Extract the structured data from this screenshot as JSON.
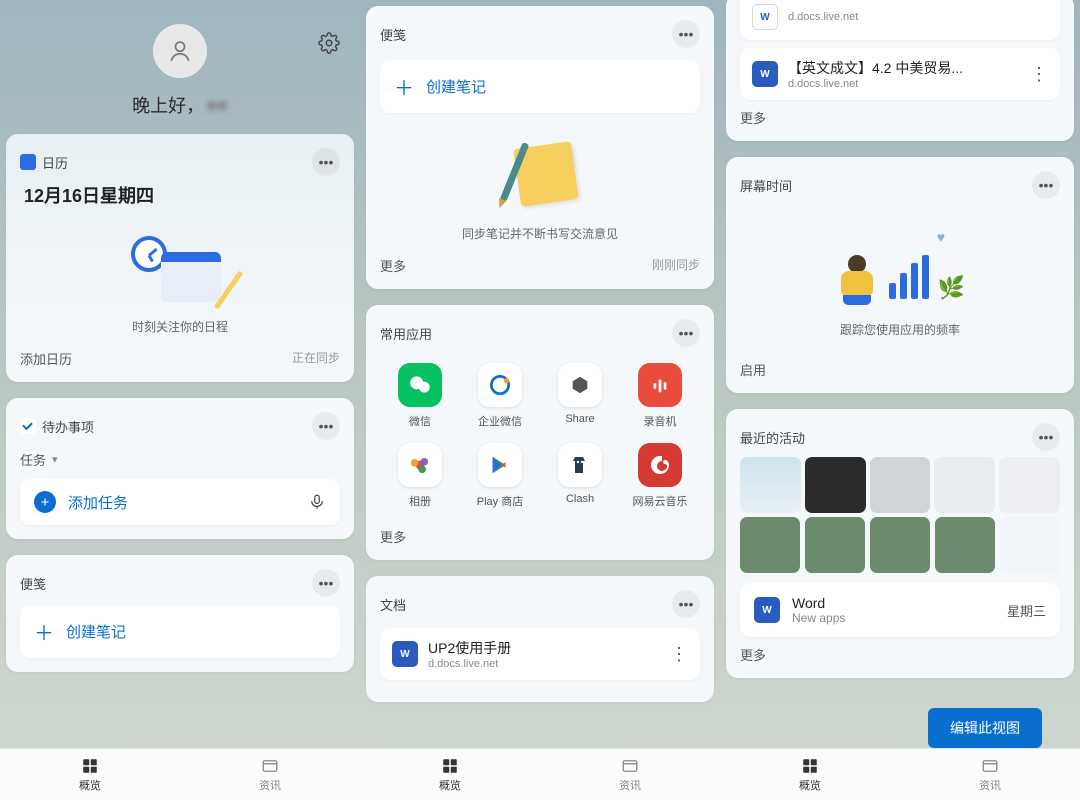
{
  "profile": {
    "greeting_prefix": "晚上好，",
    "greeting_name": "■■"
  },
  "calendar": {
    "title": "日历",
    "date": "12月16日星期四",
    "caption": "时刻关注你的日程",
    "add": "添加日历",
    "sync": "正在同步"
  },
  "todo": {
    "title": "待办事项",
    "tab": "任务",
    "add": "添加任务"
  },
  "notes1": {
    "title": "便笺",
    "create": "创建笔记"
  },
  "notes2": {
    "title": "便笺",
    "create": "创建笔记",
    "caption": "同步笔记并不断书写交流意见",
    "more": "更多",
    "sync": "刚刚同步"
  },
  "apps": {
    "title": "常用应用",
    "items": [
      {
        "name": "微信",
        "bg": "#07c160"
      },
      {
        "name": "企业微信",
        "bg": "#ffffff"
      },
      {
        "name": "Share",
        "bg": "#ffffff"
      },
      {
        "name": "录音机",
        "bg": "#e74c3c"
      },
      {
        "name": "相册",
        "bg": "#ffffff"
      },
      {
        "name": "Play 商店",
        "bg": "#ffffff"
      },
      {
        "name": "Clash",
        "bg": "#ffffff"
      },
      {
        "name": "网易云音乐",
        "bg": "#d33a31"
      }
    ],
    "more": "更多"
  },
  "docs": {
    "title": "文档",
    "items": [
      {
        "title": "UP2使用手册",
        "sub": "d.docs.live.net"
      },
      {
        "title": "【英文成文】4.2 中美贸易...",
        "sub": "d.docs.live.net"
      }
    ],
    "top_doc": {
      "sub": "d.docs.live.net"
    },
    "more": "更多"
  },
  "screentime": {
    "title": "屏幕时间",
    "caption": "跟踪您使用应用的频率",
    "enable": "启用"
  },
  "recent": {
    "title": "最近的活动",
    "app": "Word",
    "sub": "New apps",
    "date": "星期三",
    "more": "更多"
  },
  "edit_view": "编辑此视图",
  "nav": {
    "overview": "概览",
    "info": "资讯"
  }
}
